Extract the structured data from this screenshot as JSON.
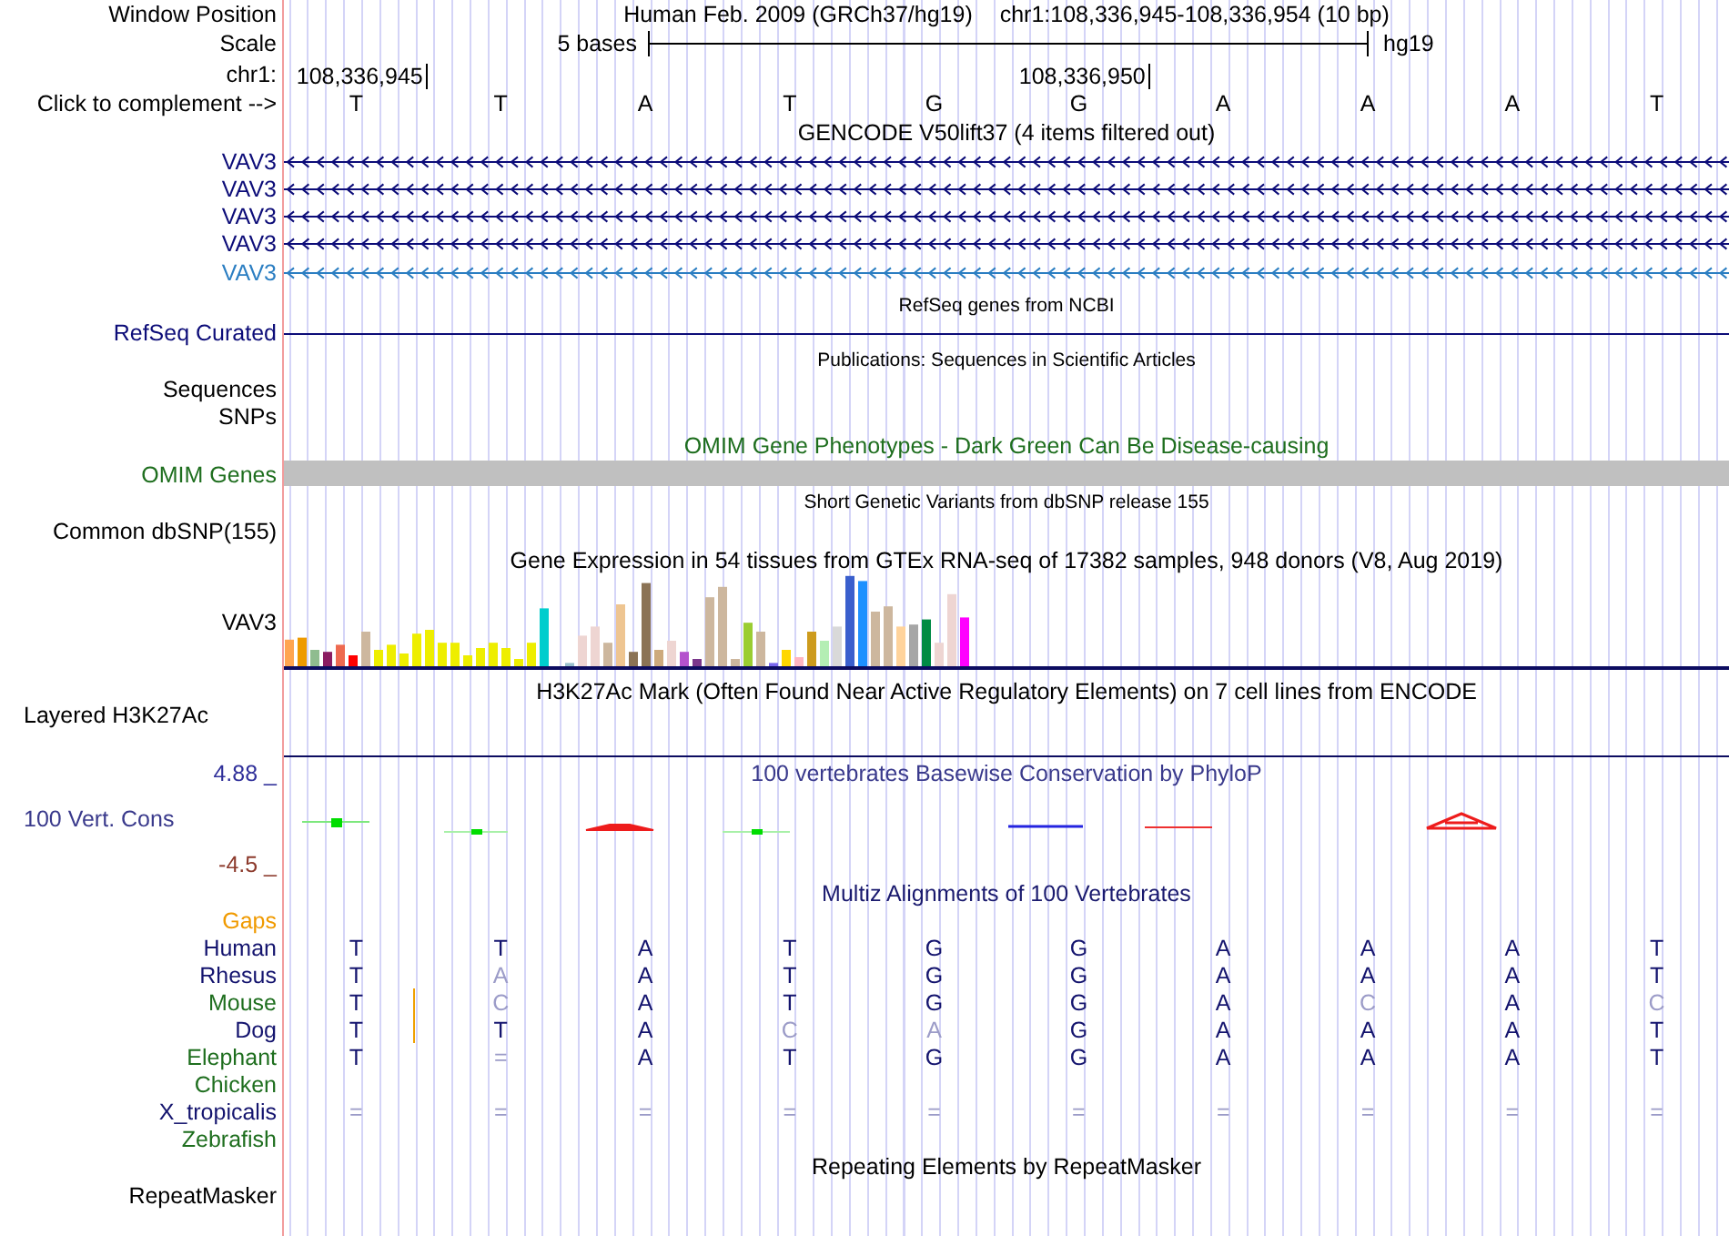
{
  "position": {
    "label": "Window Position",
    "assembly": "Human Feb. 2009 (GRCh37/hg19)",
    "range": "chr1:108,336,945-108,336,954 (10 bp)"
  },
  "scale": {
    "label": "Scale",
    "span": "5 bases",
    "assembly": "hg19"
  },
  "ruler": {
    "label": "chr1:",
    "ticks": [
      "108,336,945",
      "108,336,950"
    ]
  },
  "sequence": {
    "label": "Click to complement -->",
    "bases": [
      "T",
      "T",
      "A",
      "T",
      "G",
      "G",
      "A",
      "A",
      "A",
      "T"
    ]
  },
  "tracks": [
    {
      "kind": "gencode",
      "title": "GENCODE V50lift37 (4 items filtered out)",
      "genes": [
        {
          "name": "VAV3",
          "color": "#0c0c78"
        },
        {
          "name": "VAV3",
          "color": "#0c0c78"
        },
        {
          "name": "VAV3",
          "color": "#0c0c78"
        },
        {
          "name": "VAV3",
          "color": "#0c0c78"
        },
        {
          "name": "VAV3",
          "color": "#2b7ec2"
        }
      ]
    },
    {
      "kind": "refseq",
      "title": "RefSeq genes from NCBI",
      "label": "RefSeq Curated",
      "color": "#0c0c78"
    },
    {
      "kind": "publications",
      "title": "Publications: Sequences in Scientific Articles",
      "labels": [
        "Sequences",
        "SNPs"
      ]
    },
    {
      "kind": "omim",
      "title": "OMIM Gene Phenotypes - Dark Green Can Be Disease-causing",
      "label": "OMIM Genes",
      "color": "#1e6e1e"
    },
    {
      "kind": "dbsnp",
      "title": "Short Genetic Variants from dbSNP release 155",
      "label": "Common dbSNP(155)"
    },
    {
      "kind": "gtex",
      "title": "Gene Expression in 54 tissues from GTEx RNA-seq of 17382 samples, 948 donors (V8, Aug 2019)",
      "label": "VAV3"
    },
    {
      "kind": "layered",
      "title": "H3K27Ac Mark (Often Found Near Active Regulatory Elements) on 7 cell lines from ENCODE",
      "label": "Layered H3K27Ac"
    },
    {
      "kind": "phylop",
      "title": "100 vertebrates Basewise Conservation by PhyloP",
      "label": "100 Vert. Cons",
      "color": "#3a3a8c",
      "max": "4.88 _",
      "min": "-4.5 _"
    },
    {
      "kind": "multiz",
      "title": "Multiz Alignments of 100 Vertebrates",
      "species": [
        {
          "name": "Gaps",
          "color": "#f09a00"
        },
        {
          "name": "Human",
          "color": "#14146e",
          "bases": [
            {
              "base": "T",
              "faded": false,
              "insertion": false
            },
            {
              "base": "T",
              "faded": false,
              "insertion": false
            },
            {
              "base": "A",
              "faded": false,
              "insertion": false
            },
            {
              "base": "T",
              "faded": false,
              "insertion": false
            },
            {
              "base": "G",
              "faded": false,
              "insertion": false
            },
            {
              "base": "G",
              "faded": false,
              "insertion": false
            },
            {
              "base": "A",
              "faded": false,
              "insertion": false
            },
            {
              "base": "A",
              "faded": false,
              "insertion": false
            },
            {
              "base": "A",
              "faded": false,
              "insertion": false
            },
            {
              "base": "T",
              "faded": false,
              "insertion": false
            }
          ]
        },
        {
          "name": "Rhesus",
          "color": "#14146e",
          "bases": [
            {
              "base": "T",
              "faded": false,
              "insertion": false
            },
            {
              "base": "A",
              "faded": true,
              "insertion": false
            },
            {
              "base": "A",
              "faded": false,
              "insertion": false
            },
            {
              "base": "T",
              "faded": false,
              "insertion": false
            },
            {
              "base": "G",
              "faded": false,
              "insertion": false
            },
            {
              "base": "G",
              "faded": false,
              "insertion": false
            },
            {
              "base": "A",
              "faded": false,
              "insertion": false
            },
            {
              "base": "A",
              "faded": false,
              "insertion": false
            },
            {
              "base": "A",
              "faded": false,
              "insertion": false
            },
            {
              "base": "T",
              "faded": false,
              "insertion": false
            }
          ]
        },
        {
          "name": "Mouse",
          "color": "#1e6e1e",
          "bases": [
            {
              "base": "T",
              "faded": false,
              "insertion": true
            },
            {
              "base": "C",
              "faded": true,
              "insertion": false
            },
            {
              "base": "A",
              "faded": false,
              "insertion": false
            },
            {
              "base": "T",
              "faded": false,
              "insertion": false
            },
            {
              "base": "G",
              "faded": false,
              "insertion": false
            },
            {
              "base": "G",
              "faded": false,
              "insertion": false
            },
            {
              "base": "A",
              "faded": false,
              "insertion": false
            },
            {
              "base": "C",
              "faded": true,
              "insertion": false
            },
            {
              "base": "A",
              "faded": false,
              "insertion": false
            },
            {
              "base": "C",
              "faded": true,
              "insertion": false
            }
          ]
        },
        {
          "name": "Dog",
          "color": "#14146e",
          "bases": [
            {
              "base": "T",
              "faded": false,
              "insertion": true
            },
            {
              "base": "T",
              "faded": false,
              "insertion": false
            },
            {
              "base": "A",
              "faded": false,
              "insertion": false
            },
            {
              "base": "C",
              "faded": true,
              "insertion": false
            },
            {
              "base": "A",
              "faded": true,
              "insertion": false
            },
            {
              "base": "G",
              "faded": false,
              "insertion": false
            },
            {
              "base": "A",
              "faded": false,
              "insertion": false
            },
            {
              "base": "A",
              "faded": false,
              "insertion": false
            },
            {
              "base": "A",
              "faded": false,
              "insertion": false
            },
            {
              "base": "T",
              "faded": false,
              "insertion": false
            }
          ]
        },
        {
          "name": "Elephant",
          "color": "#1e6e1e",
          "bases": [
            {
              "base": "T",
              "faded": false,
              "insertion": false
            },
            {
              "base": "=",
              "faded": true,
              "insertion": false
            },
            {
              "base": "A",
              "faded": false,
              "insertion": false
            },
            {
              "base": "T",
              "faded": false,
              "insertion": false
            },
            {
              "base": "G",
              "faded": false,
              "insertion": false
            },
            {
              "base": "G",
              "faded": false,
              "insertion": false
            },
            {
              "base": "A",
              "faded": false,
              "insertion": false
            },
            {
              "base": "A",
              "faded": false,
              "insertion": false
            },
            {
              "base": "A",
              "faded": false,
              "insertion": false
            },
            {
              "base": "T",
              "faded": false,
              "insertion": false
            }
          ]
        },
        {
          "name": "Chicken",
          "color": "#1e6e1e"
        },
        {
          "name": "X_tropicalis",
          "color": "#14146e",
          "bases": [
            {
              "base": "=",
              "faded": true,
              "insertion": false
            },
            {
              "base": "=",
              "faded": true,
              "insertion": false
            },
            {
              "base": "=",
              "faded": true,
              "insertion": false
            },
            {
              "base": "=",
              "faded": true,
              "insertion": false
            },
            {
              "base": "=",
              "faded": true,
              "insertion": false
            },
            {
              "base": "=",
              "faded": true,
              "insertion": false
            },
            {
              "base": "=",
              "faded": true,
              "insertion": false
            },
            {
              "base": "=",
              "faded": true,
              "insertion": false
            },
            {
              "base": "=",
              "faded": true,
              "insertion": false
            },
            {
              "base": "=",
              "faded": true,
              "insertion": false
            }
          ]
        },
        {
          "name": "Zebrafish",
          "color": "#1e6e1e"
        }
      ]
    },
    {
      "kind": "rmsk",
      "title": "Repeating Elements by RepeatMasker",
      "label": "RepeatMasker"
    }
  ]
}
